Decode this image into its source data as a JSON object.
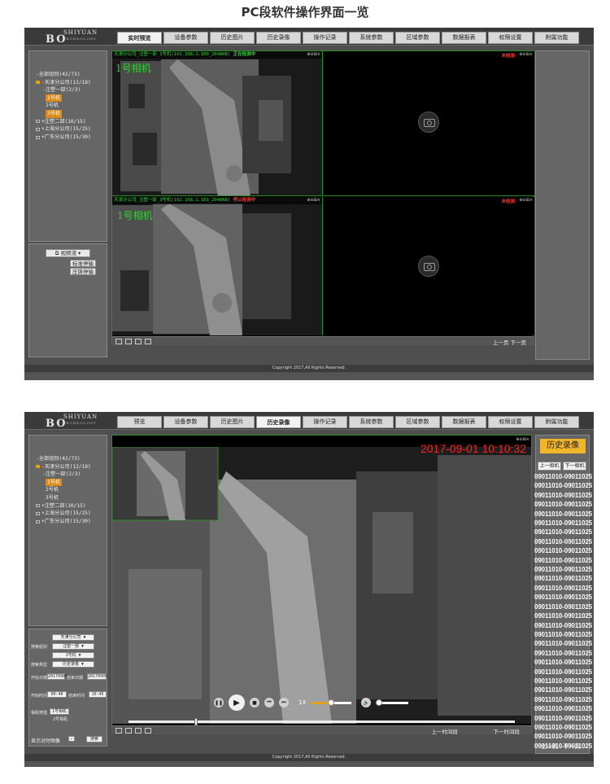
{
  "heading": "PC段软件操作界面一览",
  "logo": {
    "letters": "BO",
    "name": "SHIYUAN",
    "sub": "TECHNOLOGY"
  },
  "screen1": {
    "tabs": [
      "实时预览",
      "设备参数",
      "历史图片",
      "历史录像",
      "操作记录",
      "系统参数",
      "区域参数",
      "数据报表",
      "权限设置",
      "附属功能"
    ],
    "tree": [
      {
        "label": "-全部组别(42/73)",
        "icon": "none",
        "indent": 0
      },
      {
        "label": "-天津分公司(12/18)",
        "icon": "orange",
        "indent": 0
      },
      {
        "label": "-注塑一部(2/3)",
        "icon": "none",
        "indent": 2
      },
      {
        "label": "1号机",
        "icon": "none",
        "indent": 3,
        "highlight": true
      },
      {
        "label": "2号机",
        "icon": "none",
        "indent": 3
      },
      {
        "label": "3号机",
        "icon": "none",
        "indent": 3,
        "highlight": true
      },
      {
        "label": "+注塑二部(10/15)",
        "icon": "grey",
        "indent": 0
      },
      {
        "label": "+上海分公司(15/25)",
        "icon": "grey",
        "indent": 0
      },
      {
        "label": "+广东分公司(15/30)",
        "icon": "grey",
        "indent": 0
      }
    ],
    "stream_button": "视频流",
    "btn_standard": "标准停输",
    "btn_pressure": "压铸停输",
    "pane1_title": "天津分公司_注塑一部_1号机(192.168.1.100_2048KB)",
    "pane1_status": "正在检测中",
    "pane1_cam": "1号相机",
    "pane2_rec": "未检测",
    "pane3_title": "天津分公司_注塑一部_3号机(192.168.1.103_2048KB)",
    "pane3_status": "停止检测中",
    "pane3_cam": "1号相机",
    "pane4_rec": "未检测",
    "pane_tools": "⊕⊖⊞×",
    "pager": "上一页   下一页",
    "footer": "Copyright 2017,All Rights Reserved."
  },
  "screen2": {
    "tabs": [
      "预览",
      "设备参数",
      "历史图片",
      "历史录像",
      "操作记录",
      "系统参数",
      "区域参数",
      "数据报表",
      "权限设置",
      "附属功能"
    ],
    "tree": [
      {
        "label": "-全部组别(42/73)",
        "icon": "none",
        "indent": 0
      },
      {
        "label": "-天津分公司(12/18)",
        "icon": "orange",
        "indent": 0
      },
      {
        "label": "-注塑一部(2/3)",
        "icon": "none",
        "indent": 2
      },
      {
        "label": "1号机",
        "icon": "none",
        "indent": 3,
        "highlight": true
      },
      {
        "label": "2号机",
        "icon": "none",
        "indent": 3
      },
      {
        "label": "3号机",
        "icon": "none",
        "indent": 3
      },
      {
        "label": "+注塑二部(10/15)",
        "icon": "grey",
        "indent": 0
      },
      {
        "label": "+上海分公司(15/25)",
        "icon": "grey",
        "indent": 0
      },
      {
        "label": "+广东分公司(15/30)",
        "icon": "grey",
        "indent": 0
      }
    ],
    "query": {
      "company": "天津分公司",
      "dept_label": "搜索组别",
      "dept": "注塑一部",
      "machine": "1号机",
      "type_label": "搜索类型",
      "type": "历史录像",
      "start_date_label": "开始日期",
      "start_date": "20170901",
      "end_date_label": "结束日期",
      "end_date": "20170905",
      "start_time_label": "开始时间",
      "start_time": "00:40",
      "end_time_label": "结束时间",
      "end_time": "10:45",
      "cam_label": "相机穿插",
      "cam1": "1号相机",
      "cam2": "2号相机",
      "show_image_label": "显示对时图像",
      "search_btn": "搜索"
    },
    "timestamp": "2017-09-01 10:10:32",
    "speed": "1X",
    "speed_progress": 0.5,
    "volume_progress": 0.1,
    "timeline_progress": 0.17,
    "prev_segment": "上一时间段",
    "next_segment": "下一时间段",
    "history_title": "历史录像",
    "prev_cam": "上一相机",
    "next_cam": "下一相机",
    "segments": [
      "09011010-09011025",
      "09011010-09011025",
      "09011010-09011025",
      "09011010-09011025",
      "09011010-09011025",
      "09011010-09011025",
      "09011010-09011025",
      "09011010-09011025",
      "09011010-09011025",
      "09011010-09011025",
      "09011010-09011025",
      "09011010-09011025",
      "09011010-09011025",
      "09011010-09011025",
      "09011010-09011025",
      "09011010-09011025",
      "09011010-09011025",
      "09011010-09011025",
      "09011010-09011025",
      "09011010-09011025",
      "09011010-09011025",
      "09011010-09011025",
      "09011010-09011025",
      "09011010-09011025",
      "09011010-09011025",
      "09011010-09011025",
      "09011010-09011025",
      "09011010-09011025",
      "09011010-09011025",
      "09011010-09011025"
    ],
    "pager": "上一页 下一页",
    "footer": "Copyright 2017,All Rights Reserved."
  }
}
